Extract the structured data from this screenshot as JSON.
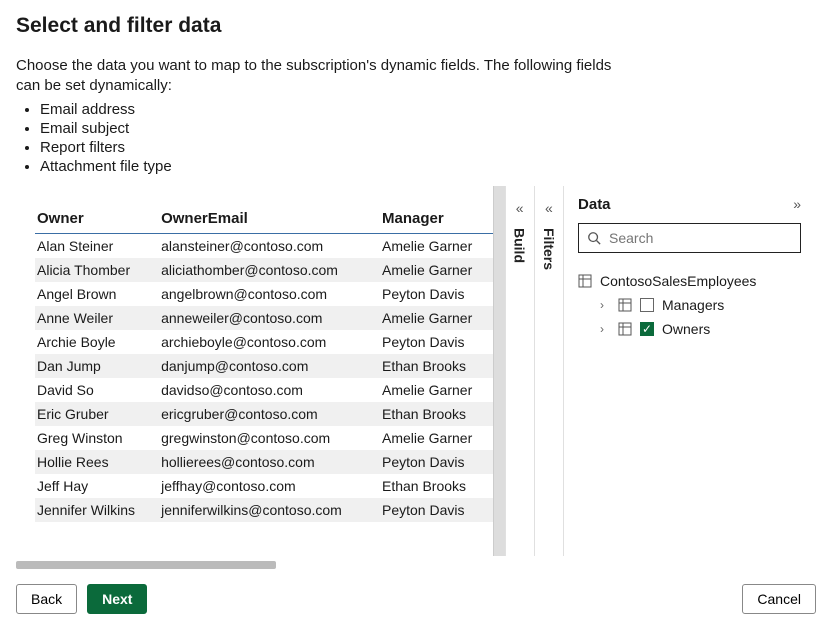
{
  "header": {
    "title": "Select and filter data"
  },
  "intro": {
    "text": "Choose the data you want to map to the subscription's dynamic fields. The following fields can be set dynamically:",
    "items": [
      "Email address",
      "Email subject",
      "Report filters",
      "Attachment file type"
    ]
  },
  "table": {
    "columns": [
      "Owner",
      "OwnerEmail",
      "Manager"
    ],
    "rows": [
      {
        "owner": "Alan Steiner",
        "email": "alansteiner@contoso.com",
        "manager": "Amelie Garner"
      },
      {
        "owner": "Alicia Thomber",
        "email": "aliciathomber@contoso.com",
        "manager": "Amelie Garner"
      },
      {
        "owner": "Angel Brown",
        "email": "angelbrown@contoso.com",
        "manager": "Peyton Davis"
      },
      {
        "owner": "Anne Weiler",
        "email": "anneweiler@contoso.com",
        "manager": "Amelie Garner"
      },
      {
        "owner": "Archie Boyle",
        "email": "archieboyle@contoso.com",
        "manager": "Peyton Davis"
      },
      {
        "owner": "Dan Jump",
        "email": "danjump@contoso.com",
        "manager": "Ethan Brooks"
      },
      {
        "owner": "David So",
        "email": "davidso@contoso.com",
        "manager": "Amelie Garner"
      },
      {
        "owner": "Eric Gruber",
        "email": "ericgruber@contoso.com",
        "manager": "Ethan Brooks"
      },
      {
        "owner": "Greg Winston",
        "email": "gregwinston@contoso.com",
        "manager": "Amelie Garner"
      },
      {
        "owner": "Hollie Rees",
        "email": "hollierees@contoso.com",
        "manager": "Peyton Davis"
      },
      {
        "owner": "Jeff Hay",
        "email": "jeffhay@contoso.com",
        "manager": "Ethan Brooks"
      },
      {
        "owner": "Jennifer Wilkins",
        "email": "jenniferwilkins@contoso.com",
        "manager": "Peyton Davis"
      }
    ]
  },
  "rails": {
    "build": "Build",
    "filters": "Filters"
  },
  "dataPanel": {
    "title": "Data",
    "search_placeholder": "Search",
    "root": "ContosoSalesEmployees",
    "nodes": [
      {
        "label": "Managers",
        "checked": false
      },
      {
        "label": "Owners",
        "checked": true
      }
    ]
  },
  "footer": {
    "back": "Back",
    "next": "Next",
    "cancel": "Cancel"
  }
}
